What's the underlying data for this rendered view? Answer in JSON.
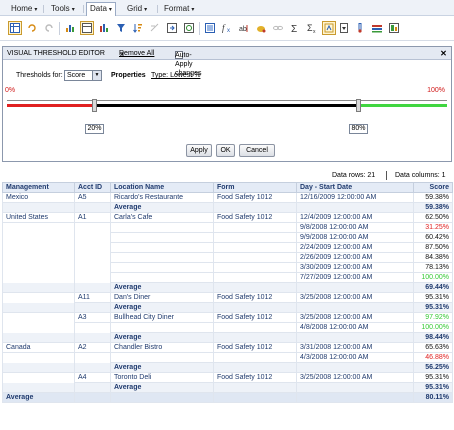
{
  "menu": {
    "items": [
      {
        "label": "Home",
        "caret": "▾"
      },
      {
        "label": "Tools",
        "caret": "▾"
      },
      {
        "label": "Data",
        "caret": "▾"
      },
      {
        "label": "Grid",
        "caret": "▾"
      },
      {
        "label": "Format",
        "caret": "▾"
      }
    ]
  },
  "toolbar": {
    "icons": [
      "grid-view-icon",
      "undo-icon",
      "redo-icon",
      "chart-icon",
      "bar-chart-icon",
      "column-chart-icon",
      "filter-icon",
      "sort-icon",
      "pivot-icon",
      "export-icon",
      "refresh-icon",
      "insert-icon",
      "formula-icon",
      "rename-icon",
      "alert-icon",
      "chain-icon",
      "sum-icon",
      "subtotal-icon",
      "threshold-icon",
      "dropdown-arrow-icon",
      "thermometer-icon",
      "bar-icon",
      "properties-icon"
    ]
  },
  "editor": {
    "title": "VISUAL THRESHOLD EDITOR",
    "remove_all_glyph": "✕",
    "remove_all": "Remove All",
    "auto_apply": "Auto-Apply changes",
    "close_glyph": "✕",
    "thresholds_for_label": "Thresholds for:",
    "thresholds_for_value": "Score",
    "properties_label": "Properties",
    "type_link": "Type: Lowest %",
    "min_label": "0%",
    "max_label": "100%",
    "low_value": "20%",
    "high_value": "80%",
    "low_fraction": 0.2,
    "high_fraction": 0.8,
    "apply": "Apply",
    "ok": "OK",
    "cancel": "Cancel",
    "colors": {
      "low": "#e02020",
      "mid": "#000000",
      "high": "#40d640"
    }
  },
  "status": {
    "rows": "Data rows: 21",
    "columns": "Data columns: 1"
  },
  "grid": {
    "headers": [
      "Management",
      "Acct ID",
      "Location Name",
      "Form",
      "Day - Start Date",
      "Score"
    ],
    "rows": [
      {
        "c": [
          "Mexico",
          "A5",
          "Ricardo's Restaurante",
          "Food Safety 1012",
          "12/16/2009 12:00:00 AM",
          "59.38%"
        ]
      },
      {
        "c": [
          "",
          "",
          "Average",
          "",
          "",
          "59.38%"
        ],
        "avg": 1
      },
      {
        "c": [
          "United States",
          "A1",
          "Carla's Cafe",
          "Food Safety 1012",
          "12/4/2009 12:00:00 AM",
          "62.50%"
        ]
      },
      {
        "c": [
          "",
          "",
          "",
          "",
          "9/8/2008 12:00:00 AM",
          "31.25%"
        ],
        "color": "red"
      },
      {
        "c": [
          "",
          "",
          "",
          "",
          "9/9/2008 12:00:00 AM",
          "60.42%"
        ]
      },
      {
        "c": [
          "",
          "",
          "",
          "",
          "2/24/2009 12:00:00 AM",
          "87.50%"
        ]
      },
      {
        "c": [
          "",
          "",
          "",
          "",
          "2/26/2009 12:00:00 AM",
          "84.38%"
        ]
      },
      {
        "c": [
          "",
          "",
          "",
          "",
          "3/30/2009 12:00:00 AM",
          "78.13%"
        ]
      },
      {
        "c": [
          "",
          "",
          "",
          "",
          "7/27/2009 12:00:00 AM",
          "100.00%"
        ],
        "color": "green"
      },
      {
        "c": [
          "",
          "",
          "Average",
          "",
          "",
          "69.44%"
        ],
        "avg": 1
      },
      {
        "c": [
          "",
          "A11",
          "Dan's Diner",
          "Food Safety 1012",
          "3/25/2008 12:00:00 AM",
          "95.31%"
        ]
      },
      {
        "c": [
          "",
          "",
          "Average",
          "",
          "",
          "95.31%"
        ],
        "avg": 1
      },
      {
        "c": [
          "",
          "A3",
          "Bullhead City Diner",
          "Food Safety 1012",
          "3/25/2008 12:00:00 AM",
          "97.92%"
        ],
        "color": "green"
      },
      {
        "c": [
          "",
          "",
          "",
          "",
          "4/8/2008 12:00:00 AM",
          "100.00%"
        ],
        "color": "green"
      },
      {
        "c": [
          "",
          "",
          "Average",
          "",
          "",
          "98.44%"
        ],
        "avg": 1
      },
      {
        "c": [
          "Canada",
          "A2",
          "Chandler Bistro",
          "Food Safety 1012",
          "3/31/2008 12:00:00 AM",
          "65.63%"
        ]
      },
      {
        "c": [
          "",
          "",
          "",
          "",
          "4/3/2008 12:00:00 AM",
          "46.88%"
        ],
        "color": "red"
      },
      {
        "c": [
          "",
          "",
          "Average",
          "",
          "",
          "56.25%"
        ],
        "avg": 1
      },
      {
        "c": [
          "",
          "A4",
          "Toronto Deli",
          "Food Safety 1012",
          "3/25/2008 12:00:00 AM",
          "95.31%"
        ]
      },
      {
        "c": [
          "",
          "",
          "Average",
          "",
          "",
          "95.31%"
        ],
        "avg": 1
      },
      {
        "c": [
          "Average",
          "",
          "",
          "",
          "",
          "80.11%"
        ],
        "avg": 2
      }
    ]
  }
}
